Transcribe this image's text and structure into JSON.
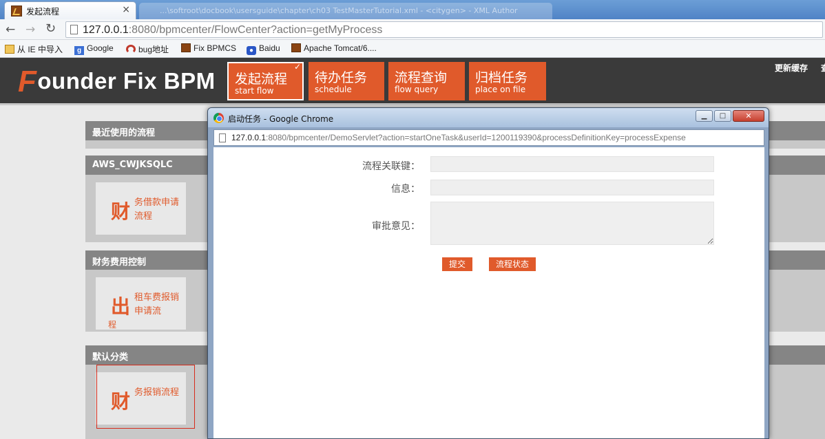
{
  "browser": {
    "tab_title": "发起流程",
    "tab_close": "×",
    "inactive_tab_text": "...\\softroot\\docbook\\usersguide\\chapter\\ch03 TestMasterTutorial.xml - <citygen> - XML Author",
    "url_host": "127.0.0.1",
    "url_rest": ":8080/bpmcenter/FlowCenter?action=getMyProcess",
    "back_icon": "arrow-left-icon",
    "forward_icon": "arrow-right-icon",
    "reload_icon": "reload-icon",
    "bookmarks": [
      {
        "label": "从 IE 中导入",
        "icon": "folder-icon",
        "color": "#e0a62b"
      },
      {
        "label": "Google",
        "icon": "google-icon",
        "color": "#3b6fd4"
      },
      {
        "label": "bug地址",
        "icon": "gauge-icon",
        "color": "#c0392b"
      },
      {
        "label": "Fix BPMCS",
        "icon": "app-icon",
        "color": "#8b4513"
      },
      {
        "label": "Baidu",
        "icon": "paw-icon",
        "color": "#2a56c6"
      },
      {
        "label": "Apache Tomcat/6....",
        "icon": "tomcat-icon",
        "color": "#8b4513"
      }
    ]
  },
  "app": {
    "logo_first": "F",
    "logo_rest": "ounder Fix BPM",
    "nav_tabs": [
      {
        "cn": "发起流程",
        "en": "start flow",
        "active": true
      },
      {
        "cn": "待办任务",
        "en": "schedule",
        "active": false
      },
      {
        "cn": "流程查询",
        "en": "flow query",
        "active": false
      },
      {
        "cn": "归档任务",
        "en": "place on file",
        "active": false
      }
    ],
    "header_link": "更新缓存",
    "header_link_cut": "查"
  },
  "sections": [
    {
      "title": "最近使用的流程",
      "cards": []
    },
    {
      "title": "AWS_CWJKSQLC",
      "cards": [
        {
          "big": "财",
          "text": "务借款申请流程",
          "overflow": ""
        }
      ]
    },
    {
      "title": "财务费用控制",
      "cards": [
        {
          "big": "出",
          "text": "租车费报销申请流",
          "overflow": "程"
        }
      ]
    },
    {
      "title": "默认分类",
      "cards": [
        {
          "big": "财",
          "text": "务报销流程",
          "overflow": ""
        }
      ]
    }
  ],
  "popup": {
    "title": "启动任务 - Google Chrome",
    "url_host": "127.0.0.1",
    "url_rest": ":8080/bpmcenter/DemoServlet?action=startOneTask&userId=1200119390&processDefinitionKey=processExpense",
    "min_label": "▁",
    "max_label": "□",
    "close_label": "✕",
    "form": {
      "key_label": "流程关联键：",
      "key_value": "",
      "info_label": "信息：",
      "info_value": "",
      "opinion_label": "审批意见：",
      "opinion_value": "",
      "submit_label": "提交",
      "status_label": "流程状态"
    }
  },
  "colors": {
    "accent": "#e05a2b",
    "header_bg": "#3a3a3a",
    "section_title_bg": "#858585",
    "highlight_border": "#d62a1a"
  }
}
